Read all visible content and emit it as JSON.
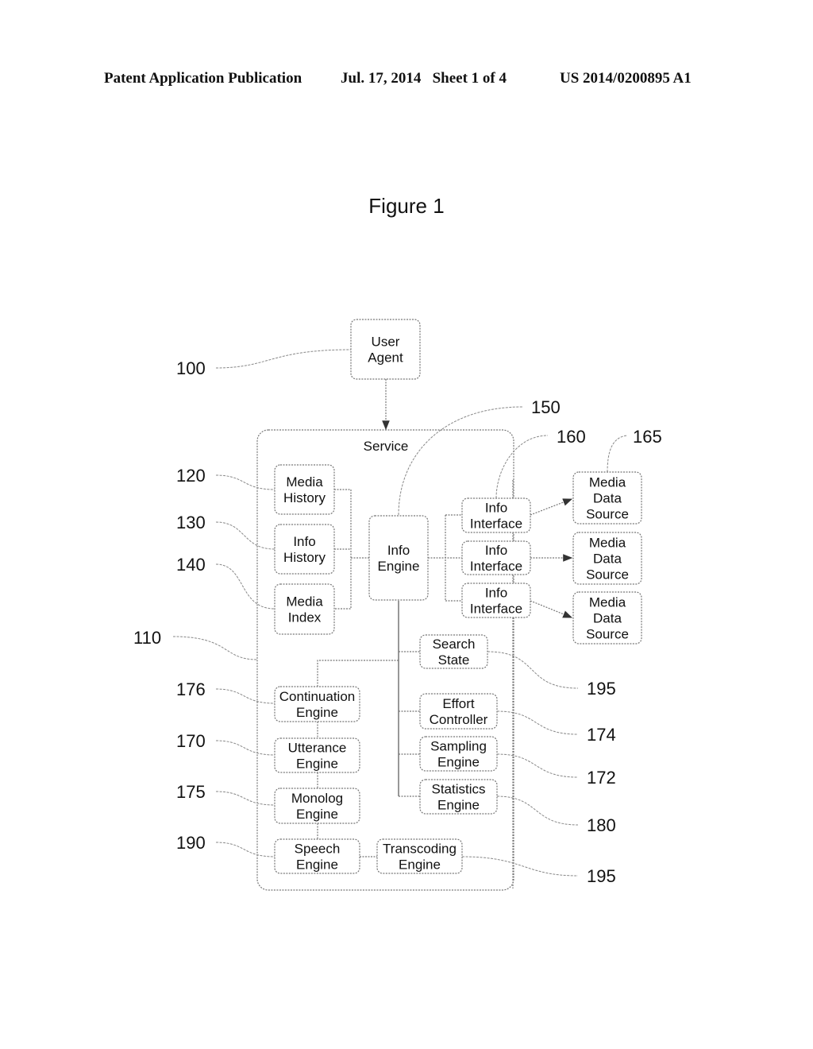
{
  "header": {
    "publication": "Patent Application Publication",
    "date_sheet": "Jul. 17, 2014   Sheet 1 of 4",
    "number": "US 2014/0200895 A1"
  },
  "figure_title": "Figure 1",
  "nodes": {
    "user_agent": [
      "User",
      "Agent"
    ],
    "service": [
      "Service"
    ],
    "media_history": [
      "Media",
      "History"
    ],
    "info_history": [
      "Info",
      "History"
    ],
    "media_index": [
      "Media",
      "Index"
    ],
    "info_engine": [
      "Info",
      "Engine"
    ],
    "info_interface_1": [
      "Info",
      "Interface"
    ],
    "info_interface_2": [
      "Info",
      "Interface"
    ],
    "info_interface_3": [
      "Info",
      "Interface"
    ],
    "media_data_source_1": [
      "Media",
      "Data",
      "Source"
    ],
    "media_data_source_2": [
      "Media",
      "Data",
      "Source"
    ],
    "media_data_source_3": [
      "Media",
      "Data",
      "Source"
    ],
    "search_state": [
      "Search",
      "State"
    ],
    "continuation_engine": [
      "Continuation",
      "Engine"
    ],
    "effort_controller": [
      "Effort",
      "Controller"
    ],
    "utterance_engine": [
      "Utterance",
      "Engine"
    ],
    "sampling_engine": [
      "Sampling",
      "Engine"
    ],
    "statistics_engine": [
      "Statistics",
      "Engine"
    ],
    "monolog_engine": [
      "Monolog",
      "Engine"
    ],
    "speech_engine": [
      "Speech",
      "Engine"
    ],
    "transcoding_engine": [
      "Transcoding",
      "Engine"
    ]
  },
  "reference_numerals": {
    "user_agent": "100",
    "service": "110",
    "media_history": "120",
    "info_history": "130",
    "media_index": "140",
    "info_engine": "150",
    "info_interface": "160",
    "media_data_source": "165",
    "continuation_engine": "176",
    "utterance_engine": "170",
    "monolog_engine": "175",
    "speech_engine": "190",
    "search_state": "195",
    "effort_controller": "174",
    "sampling_engine": "172",
    "statistics_engine": "180",
    "transcoding_engine": "195"
  }
}
